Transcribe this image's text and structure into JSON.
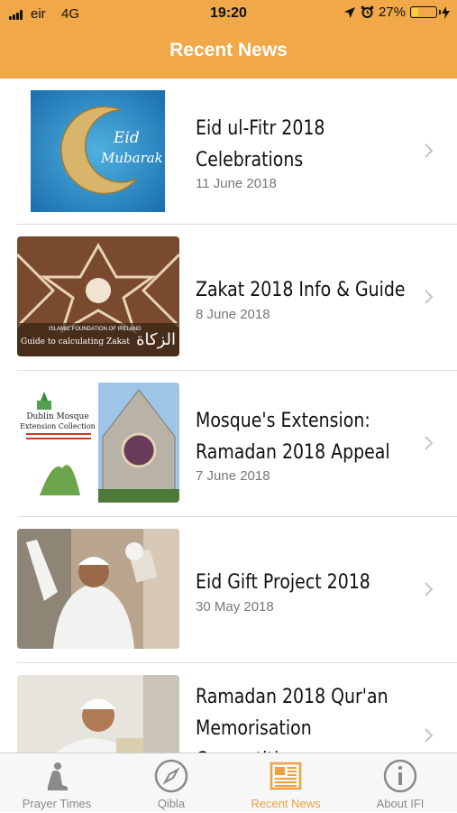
{
  "status_bar": {
    "carrier": "eir",
    "network": "4G",
    "time": "19:20",
    "battery": "27%",
    "battery_level": 0.27,
    "icons": [
      "signal-icon",
      "location-arrow-icon",
      "alarm-icon",
      "battery-icon",
      "charging-icon"
    ]
  },
  "nav": {
    "title": "Recent News",
    "bar_color": "#f0a848"
  },
  "news": [
    {
      "title_lines": [
        "Eid ul-Fitr 2018",
        "Celebrations"
      ],
      "date": "11 June 2018",
      "image_text": [
        "Eid",
        "Mubarak"
      ]
    },
    {
      "title_lines": [
        "Zakat 2018 Info & Guide"
      ],
      "date": "8 June 2018",
      "image_text": [
        "ISLAMIC FOUNDATION OF IRELAND",
        "Guide to calculating Zakat",
        "الزكاة"
      ]
    },
    {
      "title_lines": [
        "Mosque's Extension:",
        "Ramadan 2018 Appeal"
      ],
      "date": "7 June 2018",
      "image_text": [
        "Dublin Mosque",
        "Extension Collection"
      ]
    },
    {
      "title_lines": [
        "Eid Gift Project 2018"
      ],
      "date": "30 May 2018",
      "image_text": []
    },
    {
      "title_lines": [
        "Ramadan 2018 Qur'an",
        "Memorisation",
        "Competition"
      ],
      "date": "",
      "image_text": []
    }
  ],
  "tabs": [
    {
      "label": "Prayer Times",
      "icon": "prayer-icon",
      "active": false
    },
    {
      "label": "Qibla",
      "icon": "compass-icon",
      "active": false
    },
    {
      "label": "Recent News",
      "icon": "newspaper-icon",
      "active": true
    },
    {
      "label": "About IFI",
      "icon": "info-icon",
      "active": false
    }
  ],
  "colors": {
    "accent": "#f0a040",
    "inactive": "#8a8a8a"
  }
}
